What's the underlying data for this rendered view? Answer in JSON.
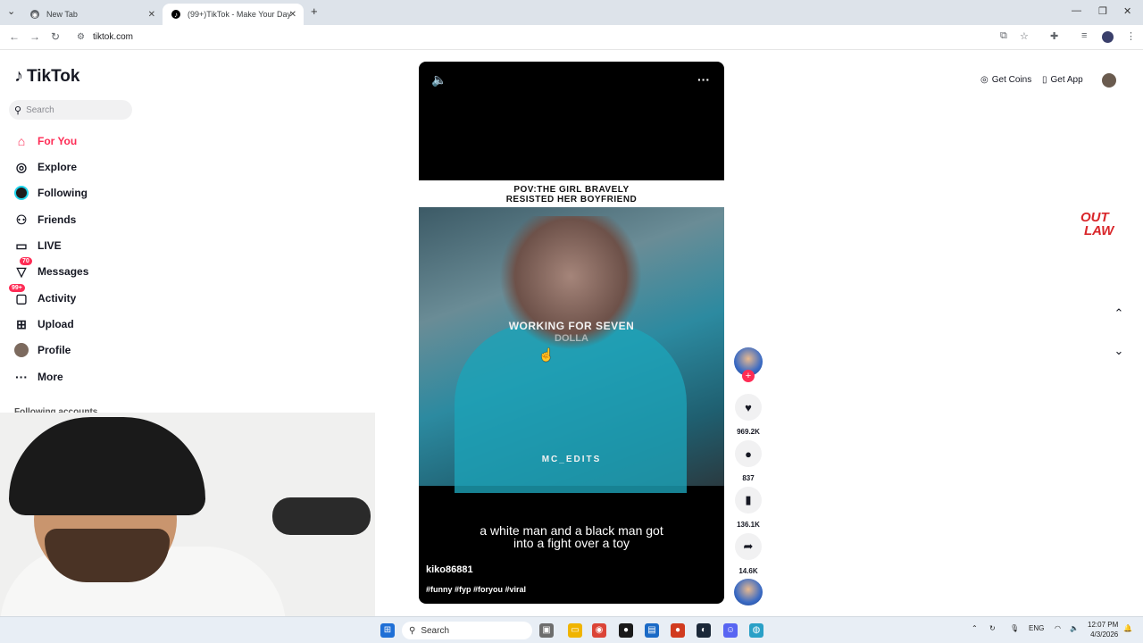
{
  "browser": {
    "tabs": [
      {
        "title": "New Tab",
        "active": false
      },
      {
        "title": "(99+)TikTok - Make Your Day",
        "active": true
      }
    ],
    "new_tab_icon": "plus-icon",
    "url": "tiktok.com"
  },
  "sidebar": {
    "logo_text": "TikTok",
    "search_placeholder": "Search",
    "items": [
      {
        "label": "For You",
        "icon": "home-icon",
        "badge": ""
      },
      {
        "label": "Explore",
        "icon": "compass-icon",
        "badge": ""
      },
      {
        "label": "Following",
        "icon": "following-icon",
        "badge": ""
      },
      {
        "label": "Friends",
        "icon": "friends-icon",
        "badge": ""
      },
      {
        "label": "LIVE",
        "icon": "live-icon",
        "badge": ""
      },
      {
        "label": "Messages",
        "icon": "messages-icon",
        "badge": "70"
      },
      {
        "label": "Activity",
        "icon": "activity-icon",
        "badge": "99+"
      },
      {
        "label": "Upload",
        "icon": "upload-icon",
        "badge": ""
      },
      {
        "label": "Profile",
        "icon": "profile-icon",
        "badge": ""
      },
      {
        "label": "More",
        "icon": "more-icon",
        "badge": ""
      }
    ],
    "following_accounts_title": "Following accounts"
  },
  "video": {
    "pov_line1": "POV:THE GIRL BRAVELY",
    "pov_line2": "RESISTED HER BOYFRIEND",
    "overlay_line1": "WORKING FOR SEVEN",
    "overlay_line2": "DOLLA",
    "watermark": "MC_EDITS",
    "caption_line1": "a white man and a black man got",
    "caption_line2": "into a fight over a toy",
    "author": "kiko86881",
    "tags": "#funny #fyp #foryou #viral"
  },
  "actions": {
    "likes": "969.2K",
    "comments": "837",
    "saves": "136.1K",
    "shares": "14.6K"
  },
  "topbar": {
    "get_coins": "Get Coins",
    "get_app": "Get App"
  },
  "brand_watermark": {
    "line1": "OUT",
    "line2": "LAW"
  },
  "taskbar": {
    "search_text": "Search",
    "lang": "ENG",
    "time": "12:07 PM",
    "date": "4/3/2026"
  },
  "colors": {
    "accent": "#fe2c55",
    "taskbar": "#e8eef5"
  }
}
